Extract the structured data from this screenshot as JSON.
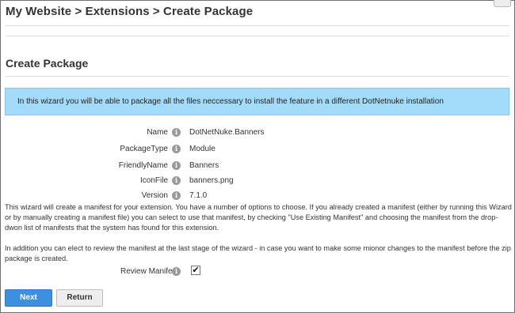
{
  "breadcrumb": "My Website > Extensions > Create Package",
  "section_title": "Create Package",
  "info_banner": "In this wizard you will be able to package all the files neccessary to install the feature in a different DotNetnuke installation",
  "fields": [
    {
      "label": "Name",
      "value": "DotNetNuke.Banners"
    },
    {
      "label": "PackageType",
      "value": "Module"
    },
    {
      "label": "FriendlyName",
      "value": "Banners"
    },
    {
      "label": "IconFile",
      "value": "banners.png"
    },
    {
      "label": "Version",
      "value": "7.1.0"
    }
  ],
  "description_1": "This wizard will create a manifest for your extension. You have a number of options to choose. If you already created a manifest (either by running this Wizard or by manually creating a manifest file) you can select to use that manifest, by checking \"Use Existing Manifest\" and choosing the manifest from the drop-dwon list of manifests that the system has found for this extension.",
  "description_2": "In addition you can elect to review the manifest at the last stage of the wizard - in case you want to make some mionor changes to the manifest before the zip package is created.",
  "review_manifest": {
    "label": "Review Manifest:",
    "checked": true
  },
  "buttons": {
    "next": "Next",
    "return": "Return"
  },
  "info_icon_glyph": "i",
  "check_glyph": "✔"
}
